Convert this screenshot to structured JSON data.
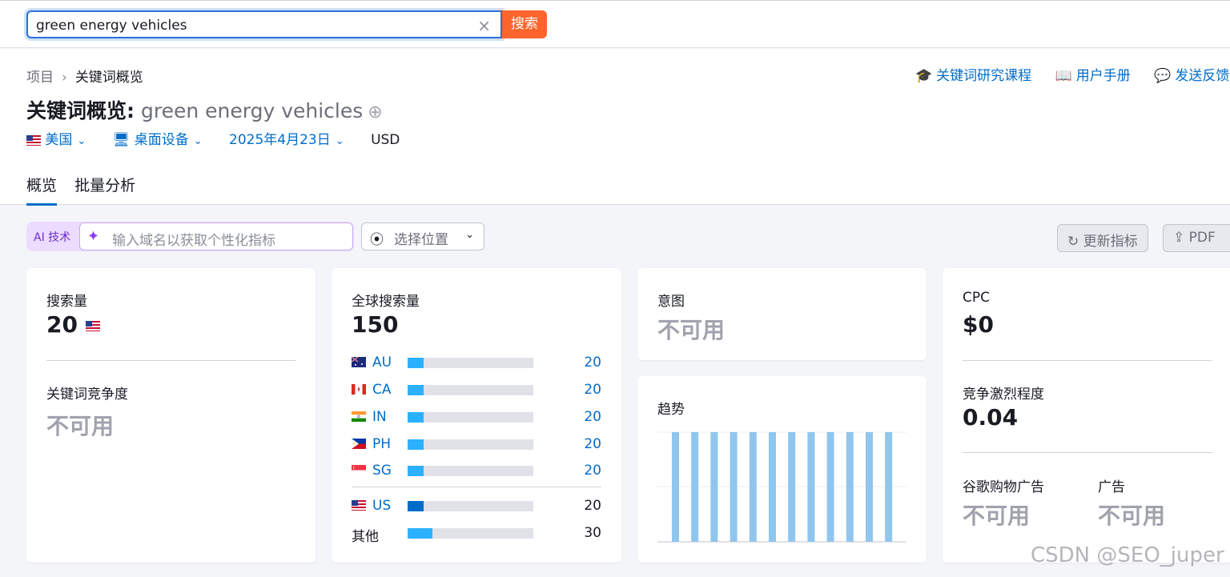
{
  "search": {
    "value": "green energy vehicles",
    "clear_icon": "×",
    "button_label": "搜索"
  },
  "breadcrumb": {
    "root": "项目",
    "separator": "›",
    "current": "关键词概览"
  },
  "top_links": [
    {
      "icon": "graduation-cap-icon",
      "glyph": "🎓",
      "label": "关键词研究课程"
    },
    {
      "icon": "book-icon",
      "glyph": "📖",
      "label": "用户手册"
    },
    {
      "icon": "comment-icon",
      "glyph": "💬",
      "label": "发送反馈"
    }
  ],
  "title": {
    "prefix": "关键词概览:",
    "keyword": "green energy vehicles",
    "add_icon": "⊕"
  },
  "filters": {
    "country": "美国",
    "device": "桌面设备",
    "date": "2025年4月23日",
    "currency": "USD",
    "chevron": "⌄"
  },
  "tabs": [
    "概览",
    "批量分析"
  ],
  "ai": {
    "label": "AI 技术",
    "placeholder": "输入域名以获取个性化指标",
    "spark": "✦"
  },
  "location": {
    "label": "选择位置",
    "pin": "⦿"
  },
  "actions": {
    "refresh": "更新指标",
    "refresh_icon": "↻",
    "pdf": "PDF",
    "pdf_icon": "⇪"
  },
  "volume_card": {
    "label": "搜索量",
    "value": "20",
    "difficulty_label": "关键词竞争度",
    "difficulty_value": "不可用"
  },
  "global_card": {
    "label": "全球搜索量",
    "value": "150",
    "rows": [
      {
        "code": "AU",
        "value": "20",
        "share": 0.13,
        "flag": "au"
      },
      {
        "code": "CA",
        "value": "20",
        "share": 0.13,
        "flag": "ca"
      },
      {
        "code": "IN",
        "value": "20",
        "share": 0.13,
        "flag": "in"
      },
      {
        "code": "PH",
        "value": "20",
        "share": 0.13,
        "flag": "ph"
      },
      {
        "code": "SG",
        "value": "20",
        "share": 0.13,
        "flag": "sg"
      }
    ],
    "us_row": {
      "code": "US",
      "value": "20",
      "share": 0.13
    },
    "other_row": {
      "code": "其他",
      "value": "30",
      "share": 0.2
    }
  },
  "intent_card": {
    "label": "意图",
    "value": "不可用"
  },
  "trend_card": {
    "label": "趋势",
    "values": [
      1,
      1,
      1,
      1,
      1,
      1,
      1,
      1,
      1,
      1,
      1,
      1
    ],
    "bar_color": "#8fc6ee"
  },
  "cpc_card": {
    "label": "CPC",
    "value": "$0",
    "competition_label": "竞争激烈程度",
    "competition_value": "0.04",
    "shopping_label": "谷歌购物广告",
    "shopping_value": "不可用",
    "ads_label": "广告",
    "ads_value": "不可用"
  },
  "watermark": "CSDN @SEO_juper"
}
